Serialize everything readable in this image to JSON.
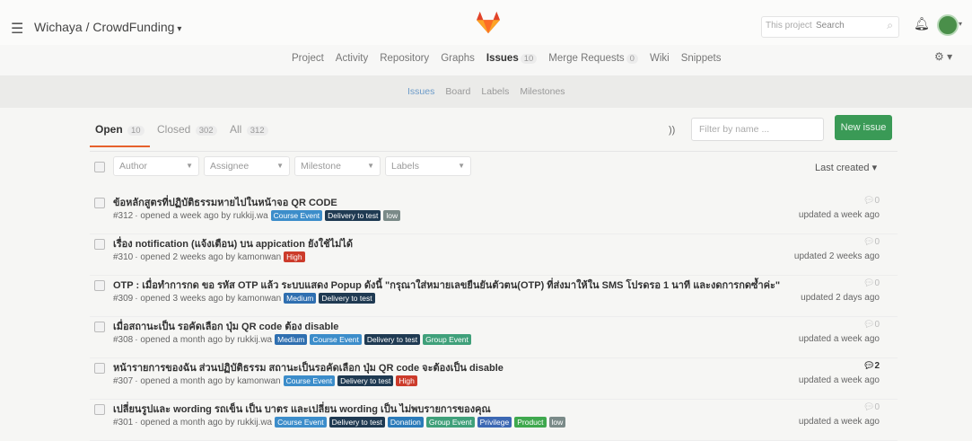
{
  "header": {
    "breadcrumb": "Wichaya / CrowdFunding",
    "search_scope": "This project",
    "search_placeholder": "Search"
  },
  "nav": {
    "items": [
      {
        "label": "Project"
      },
      {
        "label": "Activity"
      },
      {
        "label": "Repository"
      },
      {
        "label": "Graphs"
      },
      {
        "label": "Issues",
        "count": "10",
        "active": true
      },
      {
        "label": "Merge Requests",
        "count": "0"
      },
      {
        "label": "Wiki"
      },
      {
        "label": "Snippets"
      }
    ]
  },
  "subnav": {
    "items": [
      {
        "label": "Issues",
        "active": true
      },
      {
        "label": "Board"
      },
      {
        "label": "Labels"
      },
      {
        "label": "Milestones"
      }
    ]
  },
  "tabs": [
    {
      "label": "Open",
      "count": "10",
      "active": true
    },
    {
      "label": "Closed",
      "count": "302"
    },
    {
      "label": "All",
      "count": "312"
    }
  ],
  "filter_placeholder": "Filter by name ...",
  "new_issue_label": "New issue",
  "filters": {
    "author": "Author",
    "assignee": "Assignee",
    "milestone": "Milestone",
    "labels": "Labels",
    "sort": "Last created"
  },
  "colors": {
    "accent": "#e6612c",
    "new_issue": "#3a9a56",
    "course_event": "#3c8dca",
    "delivery": "#1f3a52",
    "low": "#7a8a88",
    "high": "#cc3b2b",
    "medium": "#2f6fb0",
    "group_event": "#3fa07a",
    "donation": "#2b7bb9",
    "privilege": "#3c68b3",
    "product": "#3fa84e"
  },
  "issues": [
    {
      "title": "ข้อหลักสูตรที่ปฏิบัติธรรมหายไปในหน้าจอ QR CODE",
      "number": "#312",
      "meta": "· opened a week ago by rukkij.wa",
      "labels": [
        {
          "text": "Course Event",
          "color": "#3c8dca"
        },
        {
          "text": "Delivery to test",
          "color": "#1f3a52"
        },
        {
          "text": "low",
          "color": "#7a8a88"
        }
      ],
      "comments": "0",
      "updated": "updated a week ago"
    },
    {
      "title": "เรื่อง notification (แจ้งเตือน) บน appication ยังใช้ไม่ได้",
      "number": "#310",
      "meta": "· opened 2 weeks ago by kamonwan",
      "labels": [
        {
          "text": "High",
          "color": "#cc3b2b"
        }
      ],
      "comments": "0",
      "updated": "updated 2 weeks ago"
    },
    {
      "title": "OTP : เมื่อทำการกด ขอ รหัส OTP แล้ว ระบบแสดง Popup ดังนี้ \"กรุณาใส่หมายเลขยืนยันตัวตน(OTP) ที่ส่งมาให้ใน SMS โปรดรอ 1 นาที และงดการกดซ้ำค่ะ\"",
      "number": "#309",
      "meta": "· opened 3 weeks ago by kamonwan",
      "labels": [
        {
          "text": "Medium",
          "color": "#2f6fb0"
        },
        {
          "text": "Delivery to test",
          "color": "#1f3a52"
        }
      ],
      "comments": "0",
      "updated": "updated 2 days ago"
    },
    {
      "title": "เมื่อสถานะเป็น รอคัดเลือก ปุ่ม QR code ต้อง disable",
      "number": "#308",
      "meta": "· opened a month ago by rukkij.wa",
      "labels": [
        {
          "text": "Medium",
          "color": "#2f6fb0"
        },
        {
          "text": "Course Event",
          "color": "#3c8dca"
        },
        {
          "text": "Delivery to test",
          "color": "#1f3a52"
        },
        {
          "text": "Group Event",
          "color": "#3fa07a"
        }
      ],
      "comments": "0",
      "updated": "updated a week ago"
    },
    {
      "title": "หน้ารายการของฉัน ส่วนปฏิบัติธรรม สถานะเป็นรอคัดเลือก ปุ่ม QR code จะต้องเป็น disable",
      "number": "#307",
      "meta": "· opened a month ago by kamonwan",
      "labels": [
        {
          "text": "Course Event",
          "color": "#3c8dca"
        },
        {
          "text": "Delivery to test",
          "color": "#1f3a52"
        },
        {
          "text": "High",
          "color": "#cc3b2b"
        }
      ],
      "comments": "2",
      "updated": "updated a week ago"
    },
    {
      "title": "เปลี่ยนรูปและ wording รถเข็น เป็น บาตร และเปลี่ยน wording เป็น ไม่พบรายการของคุณ",
      "number": "#301",
      "meta": "· opened a month ago by rukkij.wa",
      "labels": [
        {
          "text": "Course Event",
          "color": "#3c8dca"
        },
        {
          "text": "Delivery to test",
          "color": "#1f3a52"
        },
        {
          "text": "Donation",
          "color": "#2b7bb9"
        },
        {
          "text": "Group Event",
          "color": "#3fa07a"
        },
        {
          "text": "Privilege",
          "color": "#3c68b3"
        },
        {
          "text": "Product",
          "color": "#3fa84e"
        },
        {
          "text": "low",
          "color": "#7a8a88"
        }
      ],
      "comments": "0",
      "updated": "updated a week ago"
    }
  ]
}
